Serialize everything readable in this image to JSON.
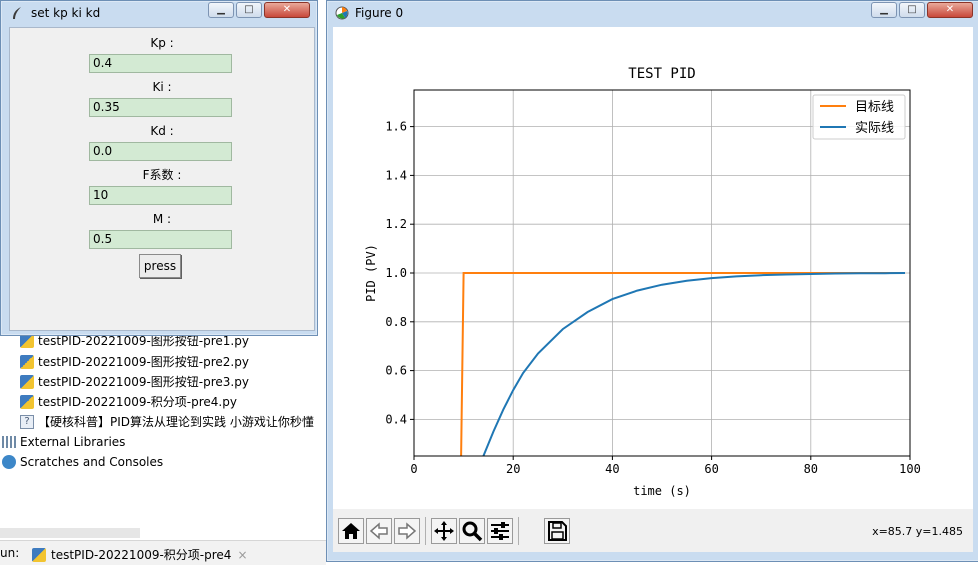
{
  "ide": {
    "files": [
      "testPID-20221009-图形按钮-pre1.py",
      "testPID-20221009-图形按钮-pre2.py",
      "testPID-20221009-图形按钮-pre3.py",
      "testPID-20221009-积分项-pre4.py",
      "【硬核科普】PID算法从理论到实践 小游戏让你秒懂"
    ],
    "external_libraries": "External Libraries",
    "scratches": "Scratches and Consoles",
    "run_label": "un:",
    "run_tab": "testPID-20221009-积分项-pre4",
    "run_tab_close": "×"
  },
  "tk_window": {
    "title": "set kp ki kd",
    "fields": [
      {
        "label": "Kp :",
        "value": "0.4"
      },
      {
        "label": "Ki :",
        "value": "0.35"
      },
      {
        "label": "Kd :",
        "value": "0.0"
      },
      {
        "label": "F系数 :",
        "value": "10"
      },
      {
        "label": "M :",
        "value": "0.5"
      }
    ],
    "button": "press"
  },
  "figure_window": {
    "title": "Figure 0",
    "status": "x=85.7 y=1.485"
  },
  "icons": {
    "home": "home-icon",
    "back": "back-arrow-icon",
    "forward": "forward-arrow-icon",
    "pan": "pan-icon",
    "zoom": "zoom-icon",
    "config": "configure-subplots-icon",
    "save": "save-icon"
  },
  "chart_data": {
    "type": "line",
    "title": "TEST PID",
    "xlabel": "time (s)",
    "ylabel": "PID (PV)",
    "xlim": [
      0,
      100
    ],
    "ylim": [
      0.25,
      1.75
    ],
    "xticks": [
      "0",
      "20",
      "40",
      "60",
      "80",
      "100"
    ],
    "yticks": [
      "0.4",
      "0.6",
      "0.8",
      "1.0",
      "1.2",
      "1.4",
      "1.6"
    ],
    "grid": true,
    "legend_position": "top-right",
    "series": [
      {
        "name": "目标线",
        "color": "#ff7f0e",
        "x": [
          9.5,
          10,
          99
        ],
        "y": [
          0.25,
          1.0,
          1.0
        ]
      },
      {
        "name": "实际线",
        "color": "#1f77b4",
        "x": [
          14,
          16,
          18,
          20,
          22,
          25,
          30,
          35,
          40,
          45,
          50,
          55,
          60,
          65,
          70,
          75,
          80,
          85,
          90,
          95,
          99
        ],
        "y": [
          0.25,
          0.35,
          0.44,
          0.52,
          0.59,
          0.67,
          0.77,
          0.84,
          0.893,
          0.928,
          0.952,
          0.968,
          0.979,
          0.986,
          0.991,
          0.994,
          0.996,
          0.998,
          0.999,
          0.999,
          1.0
        ]
      }
    ]
  }
}
